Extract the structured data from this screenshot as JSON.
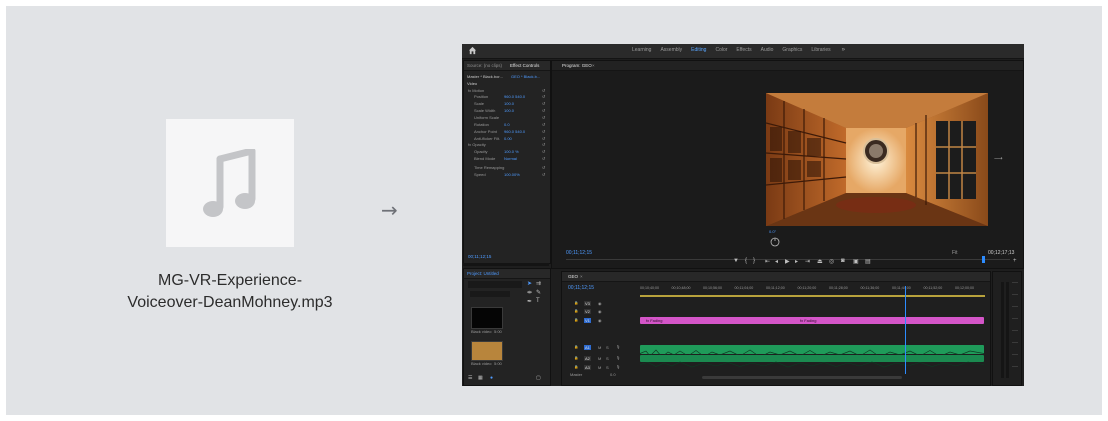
{
  "file": {
    "name_line1": "MG-VR-Experience-",
    "name_line2": "Voiceover-DeanMohney.mp3",
    "icon": "music-note-icon"
  },
  "arrow": "→",
  "editor": {
    "workspace_tabs": [
      "Learning",
      "Assembly",
      "Editing",
      "Color",
      "Effects",
      "Audio",
      "Graphics",
      "Libraries"
    ],
    "workspace_more": "»",
    "source_panel": {
      "tab_audio_mixer": "Source: (no clips)",
      "tab_effect_controls": "Effect Controls",
      "master_label": "Master * Black.bor...",
      "clip_label": "GEO * Black.b...",
      "video_header": "Video",
      "rows": [
        {
          "label": "fx  Motion"
        },
        {
          "label": "Position",
          "value": "960.0  540.0"
        },
        {
          "label": "Scale",
          "value": "100.0"
        },
        {
          "label": "Scale Width",
          "value": "100.0"
        },
        {
          "label": "Uniform Scale"
        },
        {
          "label": "Rotation",
          "value": "0.0"
        },
        {
          "label": "Anchor Point",
          "value": "960.0  540.0"
        },
        {
          "label": "Anti-flicker Filt.",
          "value": "0.00"
        },
        {
          "label": "fx  Opacity"
        },
        {
          "label": "Opacity",
          "value": "100.0 %"
        },
        {
          "label": "Blend Mode",
          "value": "Normal"
        },
        {
          "label": "Time Remapping"
        },
        {
          "label": "Speed",
          "value": "100.00%"
        }
      ],
      "timecode": "00;11;12;15"
    },
    "program_panel": {
      "tab_label": "Program: GEO",
      "timecode_left": "00;11;12;15",
      "fit_label": "Fit",
      "timecode_right": "00;12;17;13",
      "angle_label": "0.0°"
    },
    "project_panel": {
      "tab_label": "Project: Untitled",
      "clip1": "Black video",
      "clip1_dur": "5:00",
      "clip2": "Black video",
      "clip2_dur": "5:00"
    },
    "timeline_panel": {
      "tab_label": "GEO",
      "timecode": "00;11;12;15",
      "ruler": [
        "00;10;40;00",
        "00;10;48;00",
        "00;10;56;00",
        "00;11;04;00",
        "00;11;12;00",
        "00;11;20;00",
        "00;11;28;00",
        "00;11;36;00",
        "00;11;44;00",
        "00;11;52;00",
        "00;12;00;00"
      ],
      "tracks": [
        "V3",
        "V2",
        "V1",
        "A1",
        "A2",
        "A3"
      ],
      "video_clip_label": "fx  Fading",
      "master_label": "Master",
      "master_value": "0.0"
    }
  }
}
